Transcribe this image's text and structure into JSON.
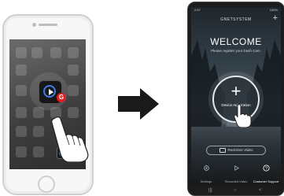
{
  "left_phone": {
    "app_badge_letter": "G"
  },
  "right_phone": {
    "status": {
      "time": "2:57",
      "battery": "100%"
    },
    "brand": "GNETSYSTEM",
    "title": "WELCOME",
    "subtitle": "Please register your Dash Cam.",
    "register_button": {
      "label": "Device registration"
    },
    "realtime_button": {
      "label": "Real-time Video"
    },
    "nav": {
      "items": [
        {
          "label": "Settings"
        },
        {
          "label": "Recorded Video"
        },
        {
          "label": "Customer Support",
          "active": true
        }
      ]
    },
    "softkeys": [
      "|||",
      "○",
      "<"
    ]
  },
  "colors": {
    "accent_blue": "#3d7eea",
    "badge_red": "#e02020",
    "arrow": "#1a1a1a"
  }
}
